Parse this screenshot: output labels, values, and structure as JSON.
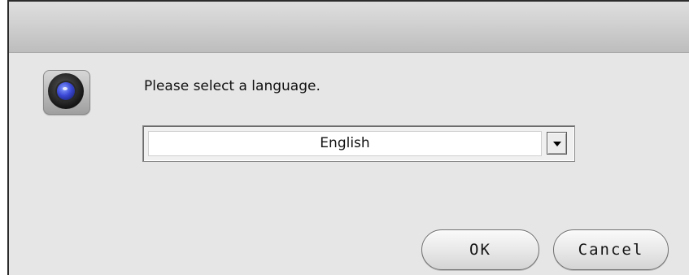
{
  "dialog": {
    "title": "",
    "prompt": "Please select a language.",
    "icon": "camera-lens-icon"
  },
  "language_select": {
    "selected": "English"
  },
  "buttons": {
    "ok_label": "OK",
    "cancel_label": "Cancel"
  },
  "colors": {
    "dialog_bg": "#e6e6e6",
    "lens_accent": "#3b49d6"
  }
}
